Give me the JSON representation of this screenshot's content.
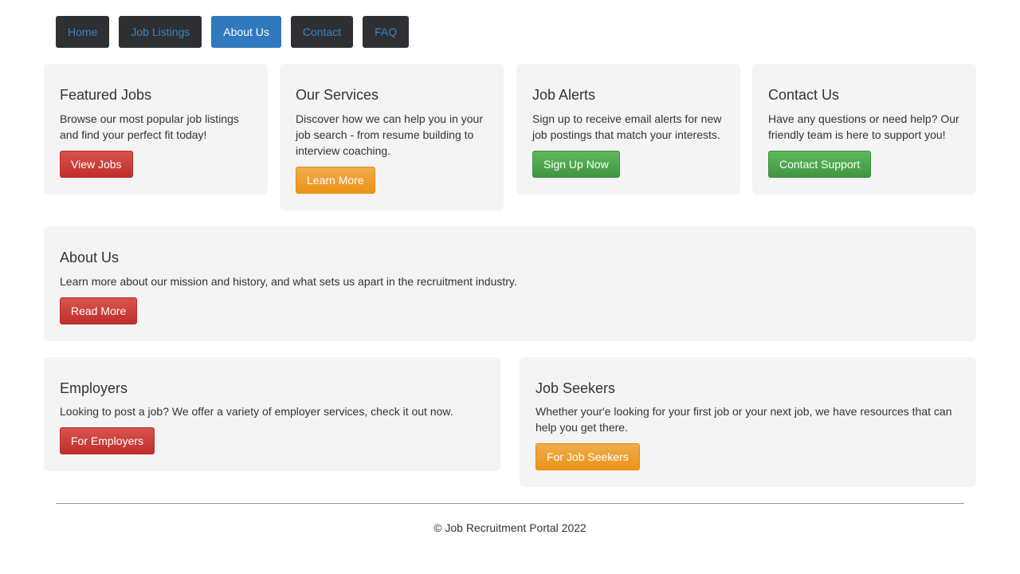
{
  "nav": {
    "items": [
      {
        "label": "Home",
        "active": false
      },
      {
        "label": "Job Listings",
        "active": false
      },
      {
        "label": "About Us",
        "active": true
      },
      {
        "label": "Contact",
        "active": false
      },
      {
        "label": "FAQ",
        "active": false
      }
    ]
  },
  "cards": {
    "featured": {
      "title": "Featured Jobs",
      "text": "Browse our most popular job listings and find your perfect fit today!",
      "button": "View Jobs"
    },
    "services": {
      "title": "Our Services",
      "text": "Discover how we can help you in your job search - from resume building to interview coaching.",
      "button": "Learn More"
    },
    "alerts": {
      "title": "Job Alerts",
      "text": "Sign up to receive email alerts for new job postings that match your interests.",
      "button": "Sign Up Now"
    },
    "contact": {
      "title": "Contact Us",
      "text": "Have any questions or need help? Our friendly team is here to support you!",
      "button": "Contact Support"
    },
    "about": {
      "title": "About Us",
      "text": "Learn more about our mission and history, and what sets us apart in the recruitment industry.",
      "button": "Read More"
    },
    "employers": {
      "title": "Employers",
      "text": "Looking to post a job? We offer a variety of employer services, check it out now.",
      "button": "For Employers"
    },
    "seekers": {
      "title": "Job Seekers",
      "text": "Whether your'e looking for your first job or your next job, we have resources that can help you get there.",
      "button": "For Job Seekers"
    }
  },
  "footer": {
    "text": "© Job Recruitment Portal 2022"
  },
  "colors": {
    "nav_bg": "#2f3033",
    "nav_link": "#3a85c8",
    "nav_active_bg": "#3079bd",
    "card_bg": "#f4f4f4",
    "btn_red": "#d9534f",
    "btn_orange": "#f0ad4e",
    "btn_green": "#5cb85c"
  }
}
